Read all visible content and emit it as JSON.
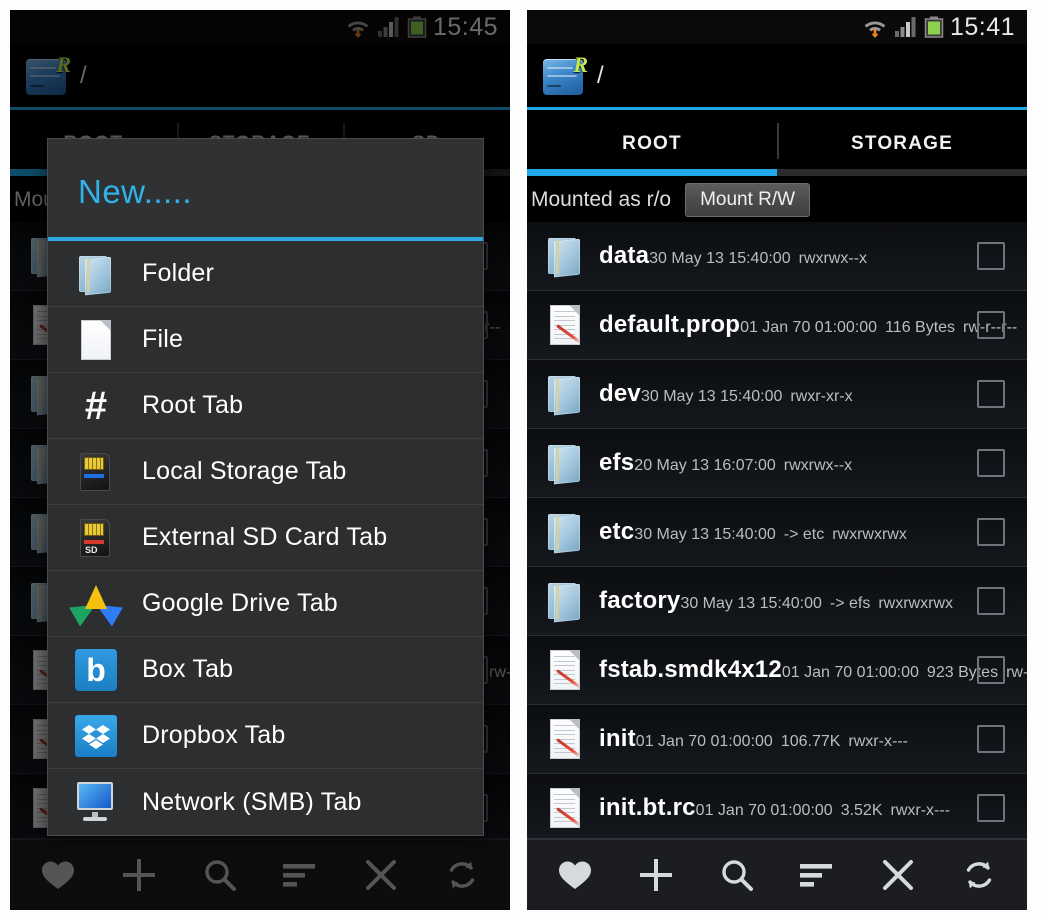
{
  "left": {
    "status_bar": {
      "time": "15:45",
      "wifi_icon": "wifi-icon",
      "signal_icon": "signal-icon",
      "battery_icon": "battery-icon"
    },
    "title_bar": {
      "app_icon": "root-browser-icon",
      "path": "/"
    },
    "background_tabs": [
      {
        "label": "ROOT",
        "active": true
      },
      {
        "label": "STORAGE",
        "active": false
      },
      {
        "label": "SD",
        "active": false
      }
    ],
    "background_mount_text": "Mou",
    "dialog": {
      "title": "New.....",
      "items": [
        {
          "icon": "folder-icon",
          "label": "Folder"
        },
        {
          "icon": "file-icon",
          "label": "File"
        },
        {
          "icon": "hash-icon",
          "label": "Root Tab"
        },
        {
          "icon": "sd-card-icon",
          "label": "Local Storage Tab"
        },
        {
          "icon": "external-sd-icon",
          "label": "External SD Card Tab"
        },
        {
          "icon": "google-drive-icon",
          "label": "Google Drive Tab"
        },
        {
          "icon": "box-icon",
          "label": "Box Tab"
        },
        {
          "icon": "dropbox-icon",
          "label": "Dropbox Tab"
        },
        {
          "icon": "monitor-icon",
          "label": "Network (SMB) Tab"
        }
      ]
    },
    "toolbar": [
      {
        "icon": "heart-icon",
        "name": "favorites-button"
      },
      {
        "icon": "plus-icon",
        "name": "new-button"
      },
      {
        "icon": "search-icon",
        "name": "search-button"
      },
      {
        "icon": "sort-icon",
        "name": "sort-button"
      },
      {
        "icon": "close-icon",
        "name": "close-button"
      },
      {
        "icon": "refresh-icon",
        "name": "refresh-button"
      }
    ]
  },
  "right": {
    "status_bar": {
      "time": "15:41",
      "wifi_icon": "wifi-icon",
      "signal_icon": "signal-icon",
      "battery_icon": "battery-icon"
    },
    "title_bar": {
      "app_icon": "root-browser-icon",
      "path": "/"
    },
    "tabs": [
      {
        "label": "ROOT",
        "active": true
      },
      {
        "label": "STORAGE",
        "active": false
      }
    ],
    "mount": {
      "status_text": "Mounted as r/o",
      "button_label": "Mount R/W"
    },
    "files": [
      {
        "type": "folder",
        "name": "data",
        "date": "30 May 13 15:40:00",
        "size": "",
        "link": "",
        "perms": "rwxrwx--x"
      },
      {
        "type": "file",
        "name": "default.prop",
        "date": "01 Jan 70 01:00:00",
        "size": "116 Bytes",
        "link": "",
        "perms": "rw-r--r--"
      },
      {
        "type": "folder",
        "name": "dev",
        "date": "30 May 13 15:40:00",
        "size": "",
        "link": "",
        "perms": "rwxr-xr-x"
      },
      {
        "type": "folder",
        "name": "efs",
        "date": "20 May 13 16:07:00",
        "size": "",
        "link": "",
        "perms": "rwxrwx--x"
      },
      {
        "type": "folder",
        "name": "etc",
        "date": "30 May 13 15:40:00",
        "size": "",
        "link": "-> etc",
        "perms": "rwxrwxrwx"
      },
      {
        "type": "folder",
        "name": "factory",
        "date": "30 May 13 15:40:00",
        "size": "",
        "link": "-> efs",
        "perms": "rwxrwxrwx"
      },
      {
        "type": "file",
        "name": "fstab.smdk4x12",
        "date": "01 Jan 70 01:00:00",
        "size": "923 Bytes",
        "link": "",
        "perms": "rw-r-----"
      },
      {
        "type": "file",
        "name": "init",
        "date": "01 Jan 70 01:00:00",
        "size": "106.77K",
        "link": "",
        "perms": "rwxr-x---"
      },
      {
        "type": "file",
        "name": "init.bt.rc",
        "date": "01 Jan 70 01:00:00",
        "size": "3.52K",
        "link": "",
        "perms": "rwxr-x---"
      }
    ],
    "toolbar": [
      {
        "icon": "heart-icon",
        "name": "favorites-button"
      },
      {
        "icon": "plus-icon",
        "name": "new-button"
      },
      {
        "icon": "search-icon",
        "name": "search-button"
      },
      {
        "icon": "sort-icon",
        "name": "sort-button"
      },
      {
        "icon": "close-icon",
        "name": "close-button"
      },
      {
        "icon": "refresh-icon",
        "name": "refresh-button"
      }
    ]
  },
  "colors": {
    "accent": "#20a8e8",
    "dialog_title": "#2fb3e8",
    "battery": "#8fd14f",
    "background": "#000000",
    "row_text": "#ffffff",
    "row_subtext": "#b9bcc1"
  }
}
